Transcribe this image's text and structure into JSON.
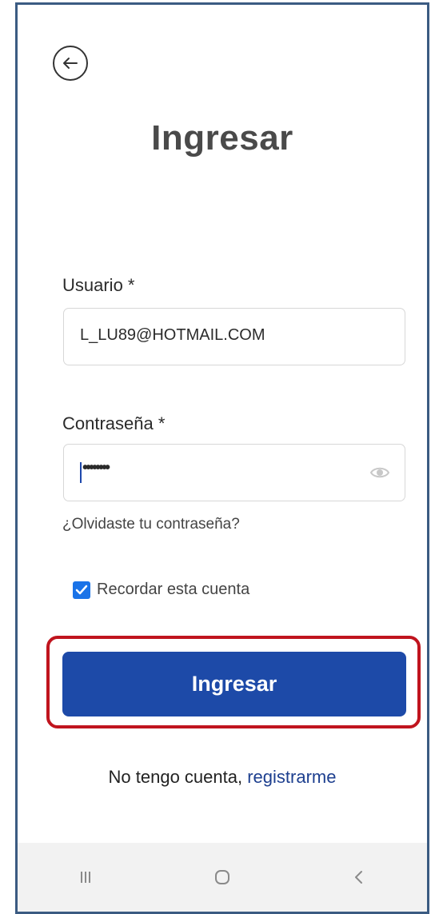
{
  "header": {
    "back_icon": "arrow-left-circle-icon",
    "title": "Ingresar"
  },
  "form": {
    "username": {
      "label": "Usuario *",
      "value": "L_LU89@HOTMAIL.COM"
    },
    "password": {
      "label": "Contraseña *",
      "masked_value": "••••••••",
      "toggle_icon": "eye-icon"
    },
    "forgot_link": "¿Olvidaste tu contraseña?",
    "remember": {
      "label": "Recordar esta cuenta",
      "checked": true
    },
    "submit_label": "Ingresar"
  },
  "footer": {
    "no_account_text": "No tengo cuenta, ",
    "register_link": "registrarme"
  },
  "navbar": {
    "items": [
      "recent-apps-icon",
      "home-icon",
      "back-icon"
    ]
  },
  "colors": {
    "primary_button": "#1d4aa8",
    "highlight": "#c0141e",
    "checkbox": "#1a73e8",
    "link": "#1d3f8f",
    "frame_border": "#3b5b82"
  }
}
